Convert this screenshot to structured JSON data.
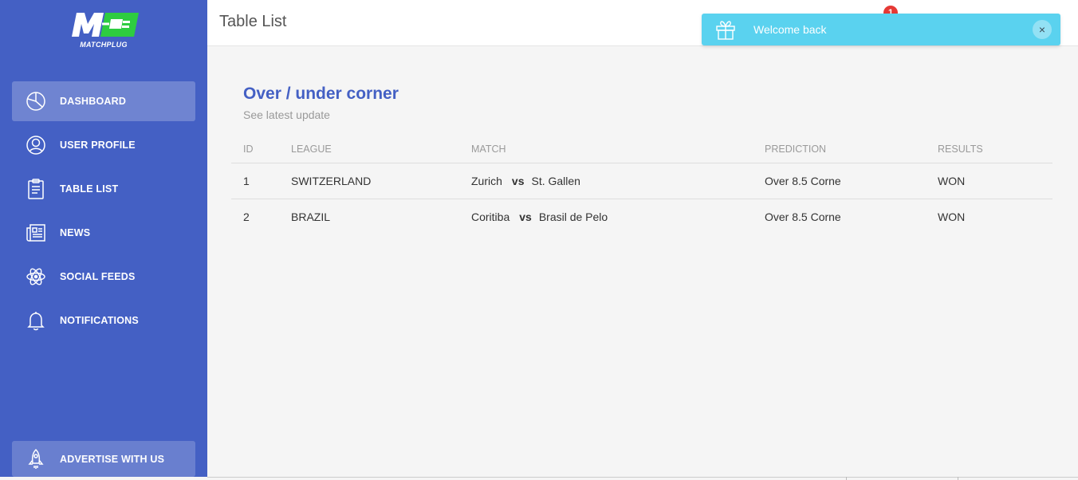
{
  "brand": {
    "name": "MATCHPLUG",
    "logo_colors": {
      "letter": "#ffffff",
      "plug": "#2ecc40"
    }
  },
  "colors": {
    "sidebar": "#4460c4",
    "accent": "#4460c4",
    "toast": "#5ad2ef",
    "badge": "#e53935"
  },
  "sidebar": {
    "items": [
      {
        "label": "DASHBOARD",
        "icon": "pie-chart-icon",
        "active": true
      },
      {
        "label": "USER PROFILE",
        "icon": "user-icon",
        "active": false
      },
      {
        "label": "TABLE LIST",
        "icon": "clipboard-icon",
        "active": false
      },
      {
        "label": "NEWS",
        "icon": "newspaper-icon",
        "active": false
      },
      {
        "label": "SOCIAL FEEDS",
        "icon": "atom-icon",
        "active": false
      },
      {
        "label": "NOTIFICATIONS",
        "icon": "bell-icon",
        "active": false
      }
    ],
    "footer": {
      "label": "ADVERTISE WITH US",
      "icon": "rocket-icon"
    }
  },
  "header": {
    "title": "Table List",
    "notification_count": "1"
  },
  "toast": {
    "message": "Welcome back",
    "icon": "gift-icon",
    "close_label": "×"
  },
  "card": {
    "title": "Over / under corner",
    "subtitle": "See latest update",
    "columns": [
      "ID",
      "LEAGUE",
      "MATCH",
      "PREDICTION",
      "RESULTS"
    ],
    "rows": [
      {
        "id": "1",
        "league": "SWITZERLAND",
        "home": "Zurich",
        "vs": "vs",
        "away": "St. Gallen",
        "prediction": "Over 8.5 Corne",
        "result": "WON"
      },
      {
        "id": "2",
        "league": "BRAZIL",
        "home": "Coritiba",
        "vs": "vs",
        "away": "Brasil de Pelo",
        "prediction": "Over 8.5 Corne",
        "result": "WON"
      }
    ]
  }
}
